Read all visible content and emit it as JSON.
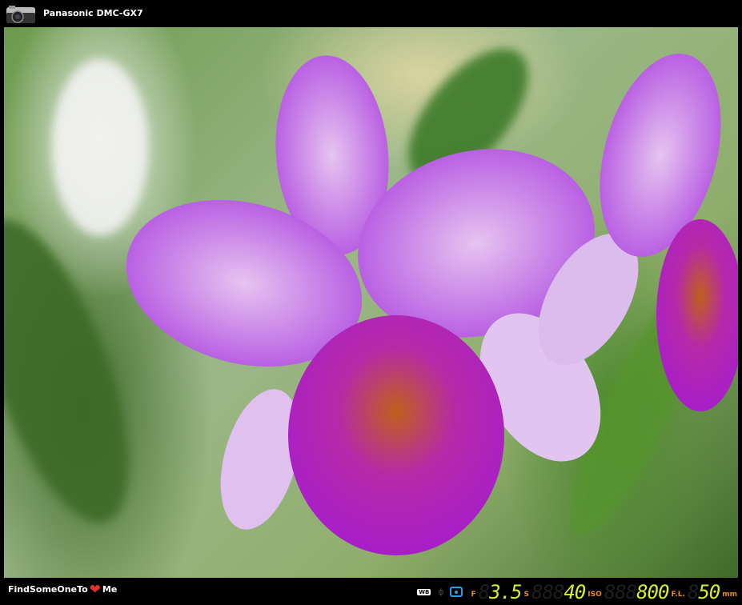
{
  "header": {
    "camera_icon": "camera-icon",
    "camera_model": "Panasonic DMC-GX7"
  },
  "footer": {
    "brand_prefix": "FindSomeOneTo",
    "brand_icon": "heart-icon",
    "brand_suffix": "Me",
    "wb_label": "WB",
    "aperture_label": "F",
    "aperture": "3.5",
    "aperture_ghost": "8",
    "shutter_label": "S",
    "shutter": "40",
    "shutter_ghost": "888",
    "iso_label": "ISO",
    "iso": "800",
    "iso_ghost": "888",
    "focal_label": "F.L.",
    "focal": "50",
    "focal_ghost": "8",
    "focal_unit": "mm"
  },
  "colors": {
    "accent_label": "#e88a1a",
    "lcd_digit": "#d8f020",
    "metering": "#2a9ee0"
  }
}
